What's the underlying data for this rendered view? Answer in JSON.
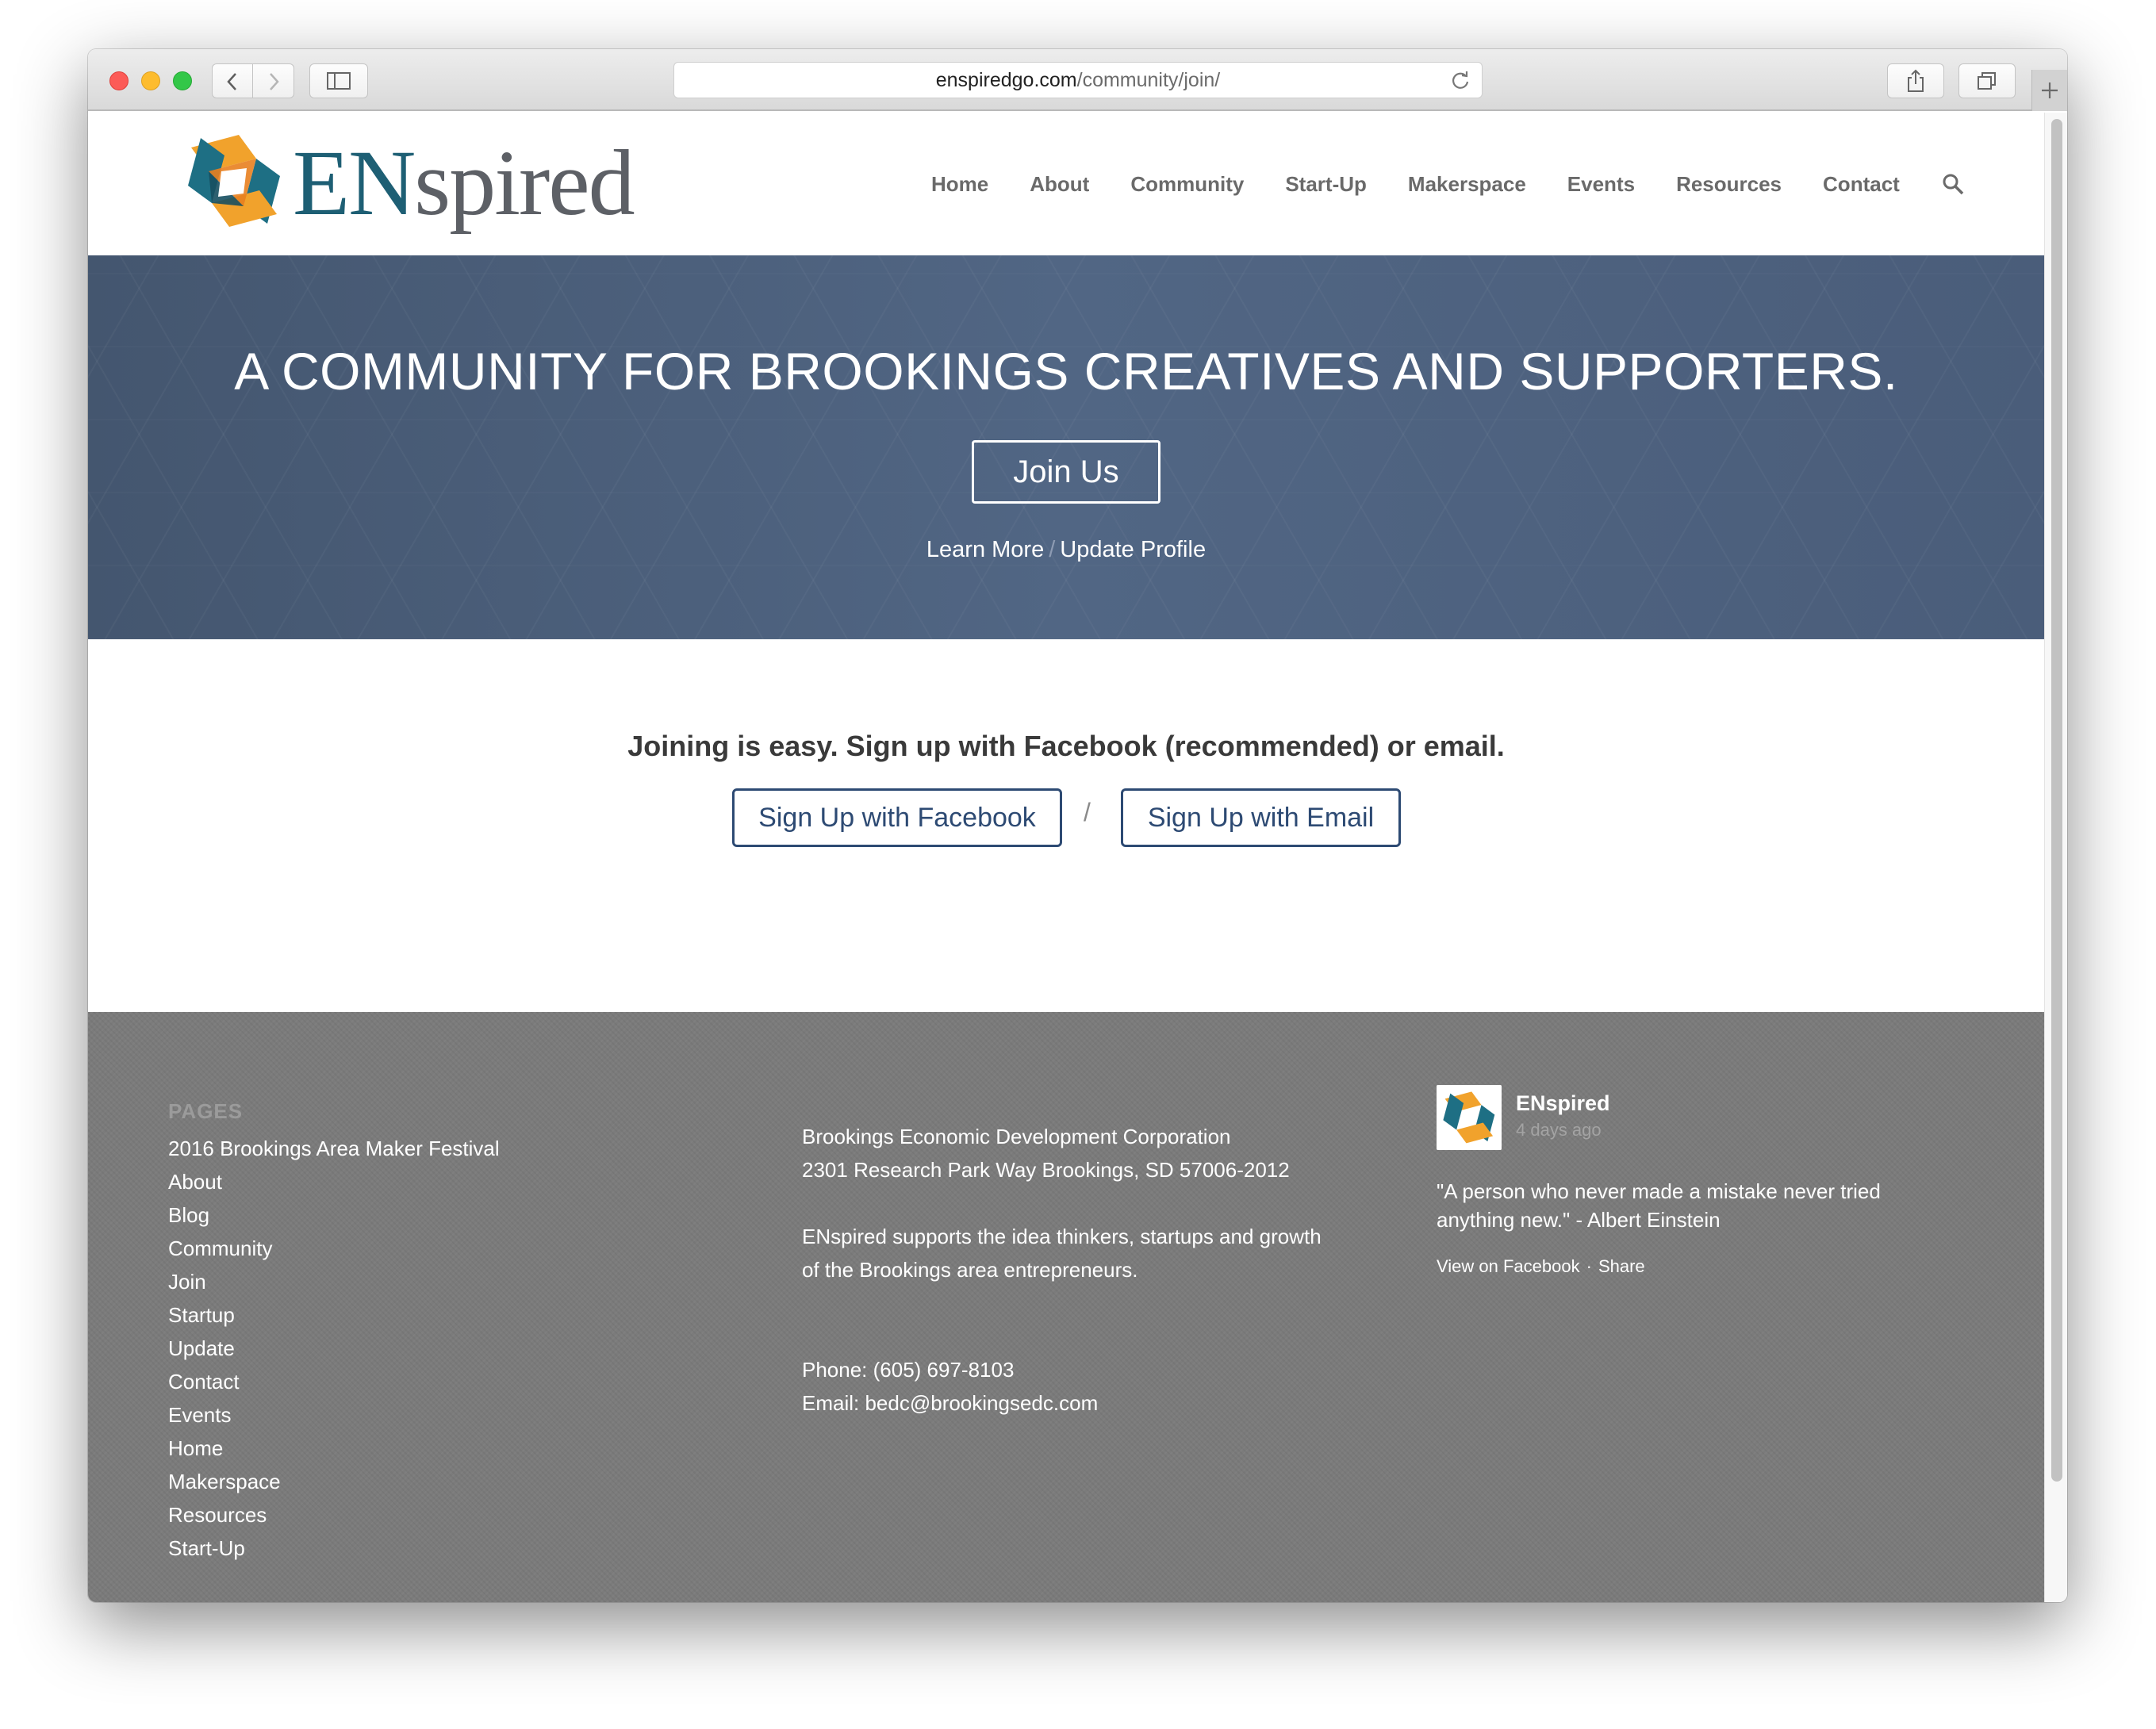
{
  "browser": {
    "url_domain": "enspiredgo.com",
    "url_path": "/community/join/"
  },
  "site": {
    "logo_en": "EN",
    "logo_spired": "spired",
    "nav": [
      "Home",
      "About",
      "Community",
      "Start-Up",
      "Makerspace",
      "Events",
      "Resources",
      "Contact"
    ],
    "colors": {
      "brand_teal": "#1e5f74",
      "brand_orange": "#f1a22c",
      "brand_blue": "#2d4a73",
      "hero_bg": "#4d6180",
      "footer_bg": "#7b7b7b"
    }
  },
  "hero": {
    "title": "A COMMUNITY FOR BROOKINGS CREATIVES AND SUPPORTERS.",
    "button": "Join Us",
    "link_learn_more": "Learn More",
    "separator": "/",
    "link_update_profile": "Update Profile"
  },
  "signup": {
    "text": "Joining is easy. Sign up with Facebook (recommended) or email.",
    "facebook_button": "Sign Up with Facebook",
    "separator": "/",
    "email_button": "Sign Up with Email"
  },
  "footer": {
    "pages_heading": "PAGES",
    "pages": [
      "2016 Brookings Area Maker Festival",
      "About",
      "Blog",
      "Community",
      "Join",
      "Startup",
      "Update",
      "Contact",
      "Events",
      "Home",
      "Makerspace",
      "Resources",
      "Start-Up"
    ],
    "org_name": "Brookings Economic Development Corporation",
    "address": "2301 Research Park Way Brookings, SD 57006-2012",
    "description_line1": "ENspired supports the idea thinkers, startups and growth",
    "description_line2": "of the Brookings area entrepreneurs.",
    "phone": "Phone: (605) 697-8103",
    "email": "Email: bedc@brookingsedc.com",
    "facebook": {
      "name": "ENspired",
      "time": "4 days ago",
      "post": "\"A person who never made a mistake never tried anything new.\" - Albert Einstein",
      "view_link": "View on Facebook",
      "dot": "·",
      "share_link": "Share"
    }
  }
}
